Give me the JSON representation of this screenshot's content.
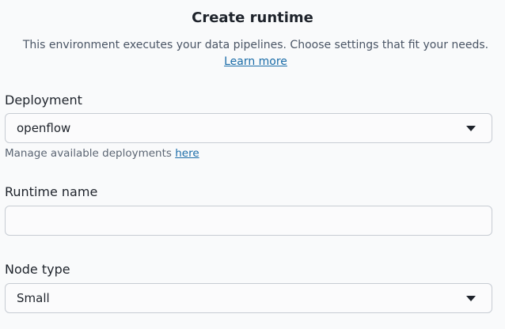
{
  "dialog": {
    "title": "Create runtime",
    "description": "This environment executes your data pipelines. Choose settings that fit your needs.",
    "learn_more": "Learn more"
  },
  "deployment": {
    "label": "Deployment",
    "selected": "openflow",
    "hint_prefix": "Manage available deployments ",
    "hint_link": "here"
  },
  "runtime_name": {
    "label": "Runtime name",
    "value": ""
  },
  "node_type": {
    "label": "Node type",
    "selected": "Small"
  },
  "icons": {
    "dropdown": "chevron-down-icon"
  }
}
